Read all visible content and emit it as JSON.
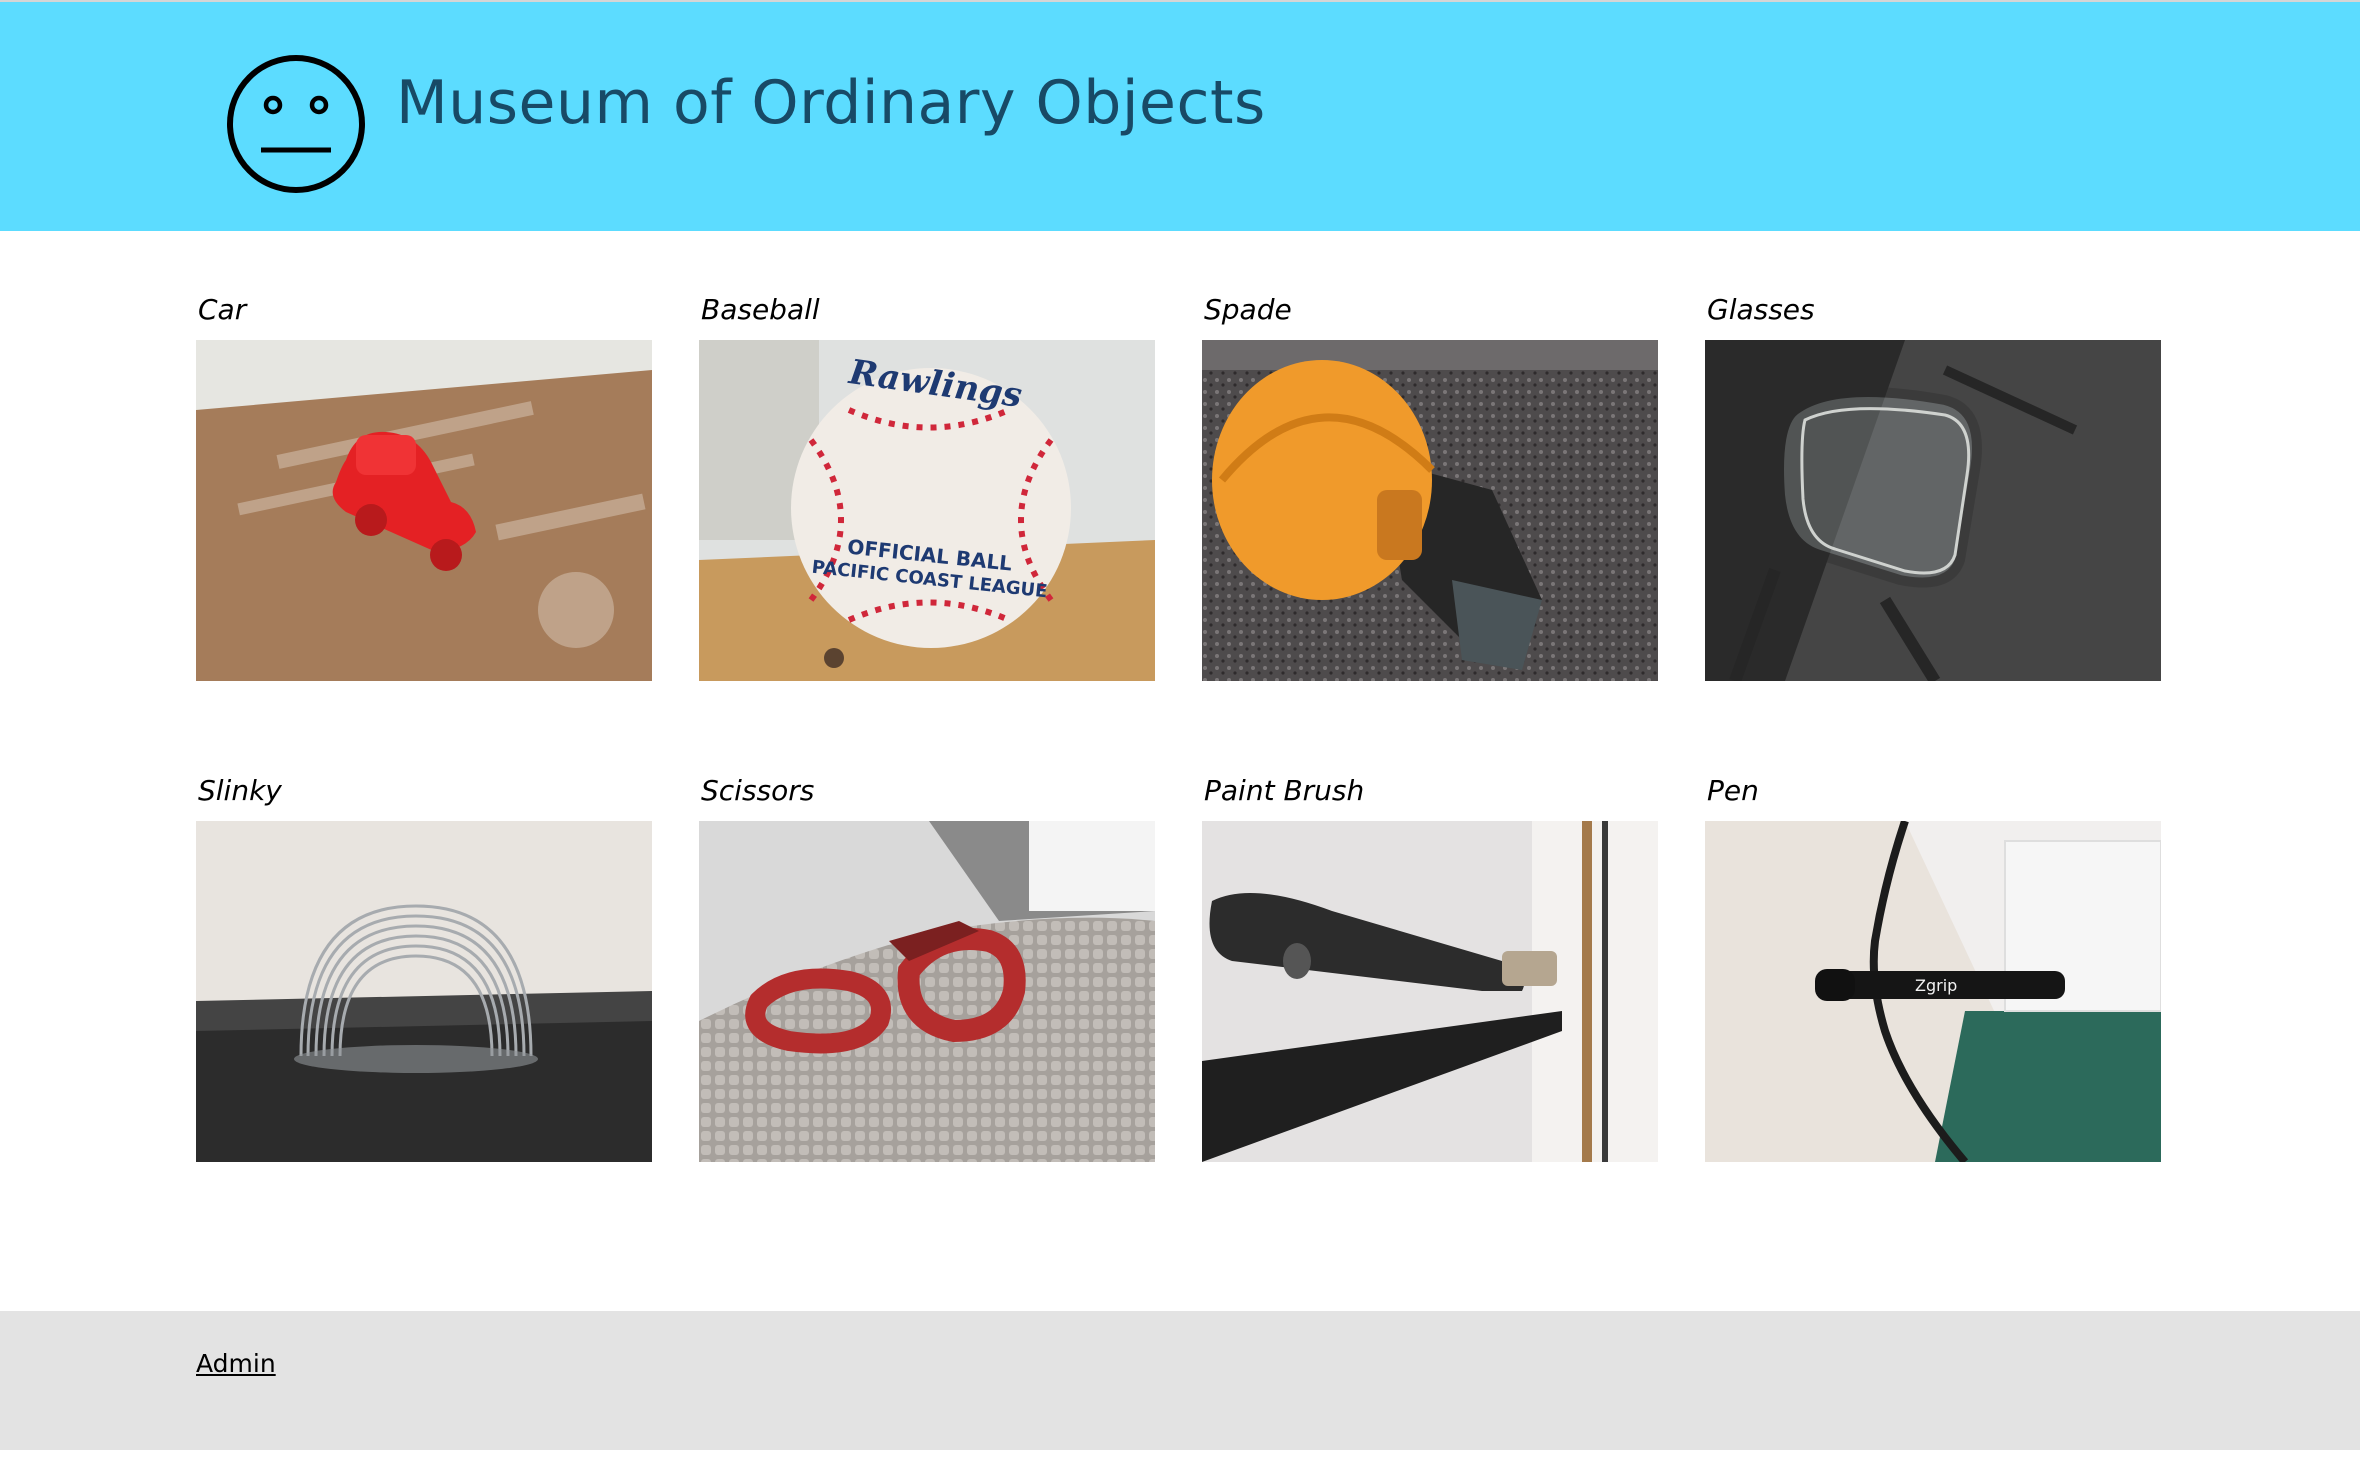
{
  "header": {
    "title": "Museum of Ordinary Objects",
    "logo_icon": "neutral-face-icon",
    "background": "#5cdcff",
    "title_color": "#184a66"
  },
  "exhibits": [
    {
      "label": "Car"
    },
    {
      "label": "Baseball",
      "badge_text": [
        "Rawlings",
        "OFFICIAL BALL",
        "PACIFIC COAST LEAGUE"
      ]
    },
    {
      "label": "Spade"
    },
    {
      "label": "Glasses"
    },
    {
      "label": "Slinky"
    },
    {
      "label": "Scissors"
    },
    {
      "label": "Paint Brush"
    },
    {
      "label": "Pen",
      "badge_text": [
        "Zgrip"
      ]
    }
  ],
  "footer": {
    "admin_label": "Admin",
    "background": "#e3e3e3"
  }
}
